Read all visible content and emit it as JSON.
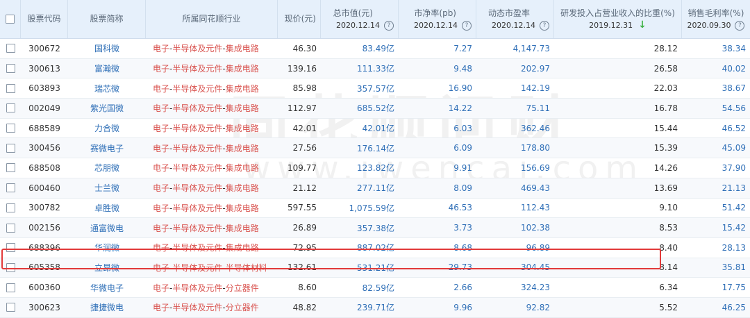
{
  "header": {
    "code": "股票代码",
    "name": "股票简称",
    "industry": "所属同花顺行业",
    "price": "现价(元)",
    "cap": "总市值(元)",
    "cap_date": "2020.12.14",
    "pb": "市净率(pb)",
    "pb_date": "2020.12.14",
    "pe": "动态市盈率",
    "pe_date": "2020.12.14",
    "rd": "研发投入占营业收入的比重(%)",
    "rd_date": "2019.12.31",
    "gm": "销售毛利率(%)",
    "gm_date": "2020.09.30",
    "help_glyph": "?",
    "sort_glyph": "↓"
  },
  "watermark": {
    "text": "同花顺问财",
    "url": "www.iwencai.com"
  },
  "rows": [
    {
      "code": "300672",
      "name": "国科微",
      "ind1": "电子",
      "ind2": "半导体及元件",
      "ind3": "集成电路",
      "price": "46.30",
      "cap": "83.49亿",
      "pb": "7.27",
      "pe": "4,147.73",
      "rd": "28.12",
      "gm": "38.34"
    },
    {
      "code": "300613",
      "name": "富瀚微",
      "ind1": "电子",
      "ind2": "半导体及元件",
      "ind3": "集成电路",
      "price": "139.16",
      "cap": "111.33亿",
      "pb": "9.48",
      "pe": "202.97",
      "rd": "26.58",
      "gm": "40.02"
    },
    {
      "code": "603893",
      "name": "瑞芯微",
      "ind1": "电子",
      "ind2": "半导体及元件",
      "ind3": "集成电路",
      "price": "85.98",
      "cap": "357.57亿",
      "pb": "16.90",
      "pe": "142.19",
      "rd": "22.03",
      "gm": "38.67"
    },
    {
      "code": "002049",
      "name": "紫光国微",
      "ind1": "电子",
      "ind2": "半导体及元件",
      "ind3": "集成电路",
      "price": "112.97",
      "cap": "685.52亿",
      "pb": "14.22",
      "pe": "75.11",
      "rd": "16.78",
      "gm": "54.56"
    },
    {
      "code": "688589",
      "name": "力合微",
      "ind1": "电子",
      "ind2": "半导体及元件",
      "ind3": "集成电路",
      "price": "42.01",
      "cap": "42.01亿",
      "pb": "6.03",
      "pe": "362.46",
      "rd": "15.44",
      "gm": "46.52"
    },
    {
      "code": "300456",
      "name": "赛微电子",
      "ind1": "电子",
      "ind2": "半导体及元件",
      "ind3": "集成电路",
      "price": "27.56",
      "cap": "176.14亿",
      "pb": "6.09",
      "pe": "178.80",
      "rd": "15.39",
      "gm": "45.09"
    },
    {
      "code": "688508",
      "name": "芯朋微",
      "ind1": "电子",
      "ind2": "半导体及元件",
      "ind3": "集成电路",
      "price": "109.77",
      "cap": "123.82亿",
      "pb": "9.91",
      "pe": "156.69",
      "rd": "14.26",
      "gm": "37.90"
    },
    {
      "code": "600460",
      "name": "士兰微",
      "ind1": "电子",
      "ind2": "半导体及元件",
      "ind3": "集成电路",
      "price": "21.12",
      "cap": "277.11亿",
      "pb": "8.09",
      "pe": "469.43",
      "rd": "13.69",
      "gm": "21.13"
    },
    {
      "code": "300782",
      "name": "卓胜微",
      "ind1": "电子",
      "ind2": "半导体及元件",
      "ind3": "集成电路",
      "price": "597.55",
      "cap": "1,075.59亿",
      "pb": "46.53",
      "pe": "112.43",
      "rd": "9.10",
      "gm": "51.42"
    },
    {
      "code": "002156",
      "name": "通富微电",
      "ind1": "电子",
      "ind2": "半导体及元件",
      "ind3": "集成电路",
      "price": "26.89",
      "cap": "357.38亿",
      "pb": "3.73",
      "pe": "102.38",
      "rd": "8.53",
      "gm": "15.42"
    },
    {
      "code": "688396",
      "name": "华润微",
      "ind1": "电子",
      "ind2": "半导体及元件",
      "ind3": "集成电路",
      "price": "72.95",
      "cap": "887.02亿",
      "pb": "8.68",
      "pe": "96.89",
      "rd": "8.40",
      "gm": "28.13"
    },
    {
      "code": "605358",
      "name": "立昂微",
      "ind1": "电子",
      "ind2": "半导体及元件",
      "ind3": "半导体材料",
      "price": "132.61",
      "cap": "531.21亿",
      "pb": "29.73",
      "pe": "304.45",
      "rd": "8.14",
      "gm": "35.81"
    },
    {
      "code": "600360",
      "name": "华微电子",
      "ind1": "电子",
      "ind2": "半导体及元件",
      "ind3": "分立器件",
      "price": "8.60",
      "cap": "82.59亿",
      "pb": "2.66",
      "pe": "324.23",
      "rd": "6.34",
      "gm": "17.75"
    },
    {
      "code": "300623",
      "name": "捷捷微电",
      "ind1": "电子",
      "ind2": "半导体及元件",
      "ind3": "分立器件",
      "price": "48.82",
      "cap": "239.71亿",
      "pb": "9.96",
      "pe": "92.82",
      "rd": "5.52",
      "gm": "46.25"
    }
  ]
}
